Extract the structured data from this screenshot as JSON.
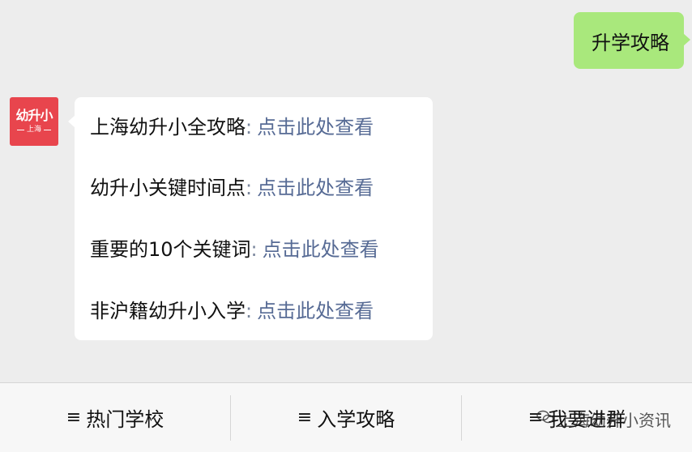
{
  "sent_message": {
    "text": "升学攻略"
  },
  "avatar": {
    "main_text": "幼升小",
    "sub_text": "上海",
    "color": "#e8454d"
  },
  "received_message": {
    "lines": [
      {
        "title": "上海幼升小全攻略",
        "separator": ":",
        "link": "点击此处查看"
      },
      {
        "title": "幼升小关键时间点",
        "separator": ":",
        "link": "点击此处查看"
      },
      {
        "title": "重要的10个关键词",
        "separator": ":",
        "link": "点击此处查看"
      },
      {
        "title": "非沪籍幼升小入学",
        "separator": ":",
        "link": "点击此处查看"
      }
    ]
  },
  "menu": {
    "items": [
      {
        "icon": "≡",
        "label": "热门学校"
      },
      {
        "icon": "≡",
        "label": "入学攻略"
      },
      {
        "icon": "≡",
        "label": "我要进群"
      }
    ]
  },
  "watermark": {
    "icon": "wechat-icon",
    "text": "上海幼升小资讯"
  },
  "colors": {
    "sent_bubble": "#a9e87c",
    "link": "#576b95",
    "background": "#ededed",
    "menu_bar": "#f7f7f7"
  }
}
